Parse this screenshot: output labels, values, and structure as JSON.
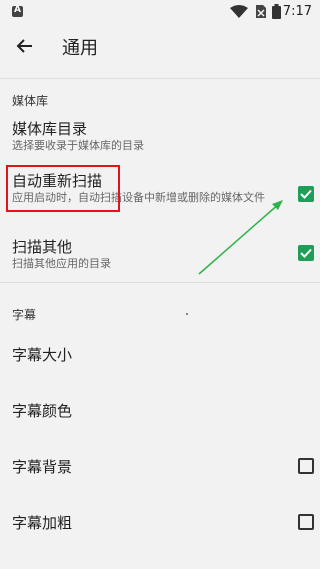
{
  "status_bar": {
    "time": "7:17"
  },
  "toolbar": {
    "title": "通用"
  },
  "sections": {
    "media_library": {
      "header": "媒体库",
      "items": [
        {
          "title": "媒体库目录",
          "summary": "选择要收录于媒体库的目录"
        },
        {
          "title": "自动重新扫描",
          "summary": "应用启动时，自动扫描设备中新增或删除的媒体文件",
          "checked": true
        },
        {
          "title": "扫描其他",
          "summary": "扫描其他应用的目录",
          "checked": true
        }
      ]
    },
    "subtitles": {
      "header": "字幕",
      "items": [
        {
          "title": "字幕大小"
        },
        {
          "title": "字幕颜色"
        },
        {
          "title": "字幕背景",
          "checked": false
        },
        {
          "title": "字幕加粗",
          "checked": false
        }
      ]
    }
  },
  "colors": {
    "accent": "#1e9e57",
    "annotation_box": "#e0141b",
    "annotation_arrow": "#2db34a"
  }
}
